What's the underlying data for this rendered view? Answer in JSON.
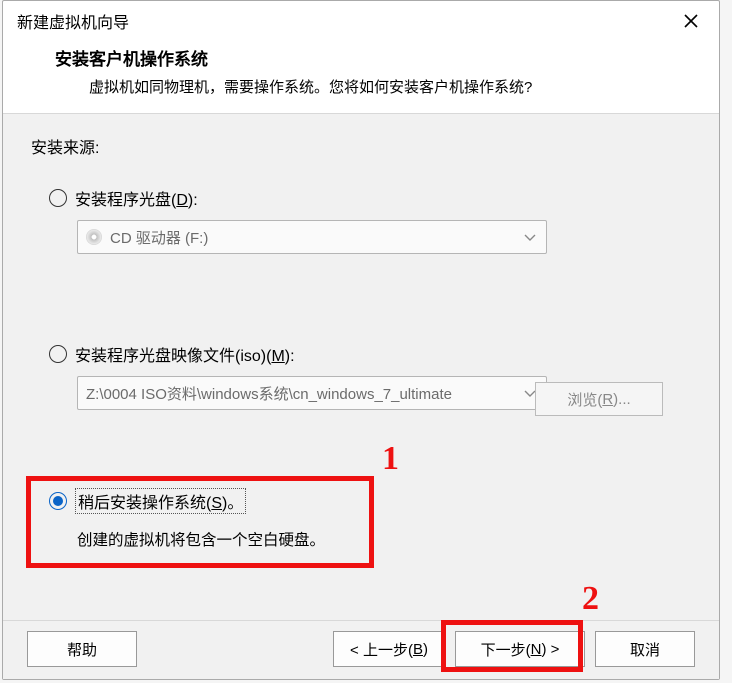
{
  "window": {
    "title": "新建虚拟机向导"
  },
  "header": {
    "title": "安装客户机操作系统",
    "description": "虚拟机如同物理机，需要操作系统。您将如何安装客户机操作系统?"
  },
  "body": {
    "source_label": "安装来源:",
    "opt_disc": {
      "label_pre": "安装程序光盘(",
      "mnemonic": "D",
      "label_post": "):",
      "combo_value": "CD 驱动器 (F:)"
    },
    "opt_iso": {
      "label_pre": "安装程序光盘映像文件(iso)(",
      "mnemonic": "M",
      "label_post": "):",
      "combo_value": "Z:\\0004 ISO资料\\windows系统\\cn_windows_7_ultimate",
      "browse_pre": "浏览(",
      "browse_mn": "R",
      "browse_post": ")..."
    },
    "opt_later": {
      "label_pre": "稍后安装操作系统(",
      "mnemonic": "S",
      "label_post": ")。",
      "note": "创建的虚拟机将包含一个空白硬盘。"
    }
  },
  "footer": {
    "help": "帮助",
    "back_pre": "< 上一步(",
    "back_mn": "B",
    "back_post": ")",
    "next_pre": "下一步(",
    "next_mn": "N",
    "next_post": ") >",
    "cancel": "取消"
  },
  "annotations": {
    "one": "1",
    "two": "2"
  }
}
